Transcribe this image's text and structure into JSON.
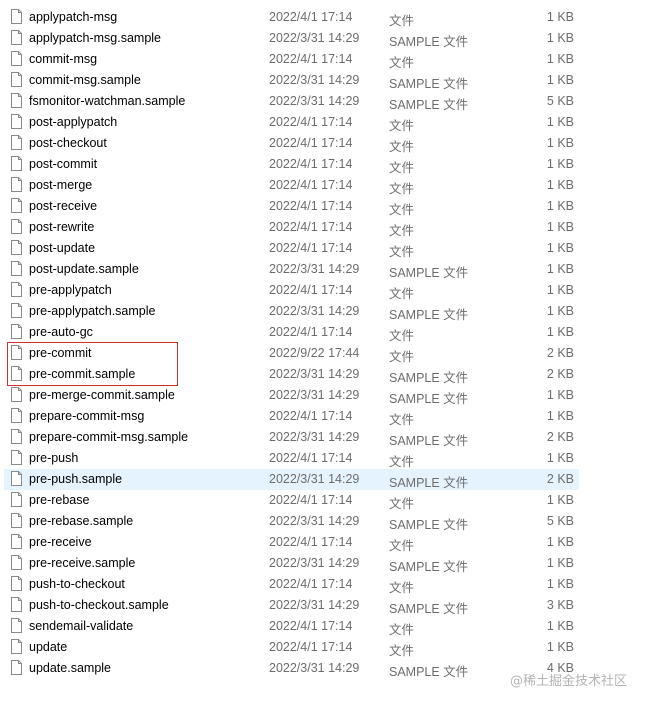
{
  "files": [
    {
      "name": "applypatch-msg",
      "date": "2022/4/1 17:14",
      "type": "文件",
      "size": "1 KB"
    },
    {
      "name": "applypatch-msg.sample",
      "date": "2022/3/31 14:29",
      "type": "SAMPLE 文件",
      "size": "1 KB"
    },
    {
      "name": "commit-msg",
      "date": "2022/4/1 17:14",
      "type": "文件",
      "size": "1 KB"
    },
    {
      "name": "commit-msg.sample",
      "date": "2022/3/31 14:29",
      "type": "SAMPLE 文件",
      "size": "1 KB"
    },
    {
      "name": "fsmonitor-watchman.sample",
      "date": "2022/3/31 14:29",
      "type": "SAMPLE 文件",
      "size": "5 KB"
    },
    {
      "name": "post-applypatch",
      "date": "2022/4/1 17:14",
      "type": "文件",
      "size": "1 KB"
    },
    {
      "name": "post-checkout",
      "date": "2022/4/1 17:14",
      "type": "文件",
      "size": "1 KB"
    },
    {
      "name": "post-commit",
      "date": "2022/4/1 17:14",
      "type": "文件",
      "size": "1 KB"
    },
    {
      "name": "post-merge",
      "date": "2022/4/1 17:14",
      "type": "文件",
      "size": "1 KB"
    },
    {
      "name": "post-receive",
      "date": "2022/4/1 17:14",
      "type": "文件",
      "size": "1 KB"
    },
    {
      "name": "post-rewrite",
      "date": "2022/4/1 17:14",
      "type": "文件",
      "size": "1 KB"
    },
    {
      "name": "post-update",
      "date": "2022/4/1 17:14",
      "type": "文件",
      "size": "1 KB"
    },
    {
      "name": "post-update.sample",
      "date": "2022/3/31 14:29",
      "type": "SAMPLE 文件",
      "size": "1 KB"
    },
    {
      "name": "pre-applypatch",
      "date": "2022/4/1 17:14",
      "type": "文件",
      "size": "1 KB"
    },
    {
      "name": "pre-applypatch.sample",
      "date": "2022/3/31 14:29",
      "type": "SAMPLE 文件",
      "size": "1 KB"
    },
    {
      "name": "pre-auto-gc",
      "date": "2022/4/1 17:14",
      "type": "文件",
      "size": "1 KB"
    },
    {
      "name": "pre-commit",
      "date": "2022/9/22 17:44",
      "type": "文件",
      "size": "2 KB"
    },
    {
      "name": "pre-commit.sample",
      "date": "2022/3/31 14:29",
      "type": "SAMPLE 文件",
      "size": "2 KB"
    },
    {
      "name": "pre-merge-commit.sample",
      "date": "2022/3/31 14:29",
      "type": "SAMPLE 文件",
      "size": "1 KB"
    },
    {
      "name": "prepare-commit-msg",
      "date": "2022/4/1 17:14",
      "type": "文件",
      "size": "1 KB"
    },
    {
      "name": "prepare-commit-msg.sample",
      "date": "2022/3/31 14:29",
      "type": "SAMPLE 文件",
      "size": "2 KB"
    },
    {
      "name": "pre-push",
      "date": "2022/4/1 17:14",
      "type": "文件",
      "size": "1 KB"
    },
    {
      "name": "pre-push.sample",
      "date": "2022/3/31 14:29",
      "type": "SAMPLE 文件",
      "size": "2 KB",
      "selected": true
    },
    {
      "name": "pre-rebase",
      "date": "2022/4/1 17:14",
      "type": "文件",
      "size": "1 KB"
    },
    {
      "name": "pre-rebase.sample",
      "date": "2022/3/31 14:29",
      "type": "SAMPLE 文件",
      "size": "5 KB"
    },
    {
      "name": "pre-receive",
      "date": "2022/4/1 17:14",
      "type": "文件",
      "size": "1 KB"
    },
    {
      "name": "pre-receive.sample",
      "date": "2022/3/31 14:29",
      "type": "SAMPLE 文件",
      "size": "1 KB"
    },
    {
      "name": "push-to-checkout",
      "date": "2022/4/1 17:14",
      "type": "文件",
      "size": "1 KB"
    },
    {
      "name": "push-to-checkout.sample",
      "date": "2022/3/31 14:29",
      "type": "SAMPLE 文件",
      "size": "3 KB"
    },
    {
      "name": "sendemail-validate",
      "date": "2022/4/1 17:14",
      "type": "文件",
      "size": "1 KB"
    },
    {
      "name": "update",
      "date": "2022/4/1 17:14",
      "type": "文件",
      "size": "1 KB"
    },
    {
      "name": "update.sample",
      "date": "2022/3/31 14:29",
      "type": "SAMPLE 文件",
      "size": "4 KB"
    }
  ],
  "icon": "file-icon",
  "highlight": {
    "color": "#d32f2f"
  },
  "selection_color": "#e5f3ff",
  "watermark": "@稀土掘金技术社区"
}
